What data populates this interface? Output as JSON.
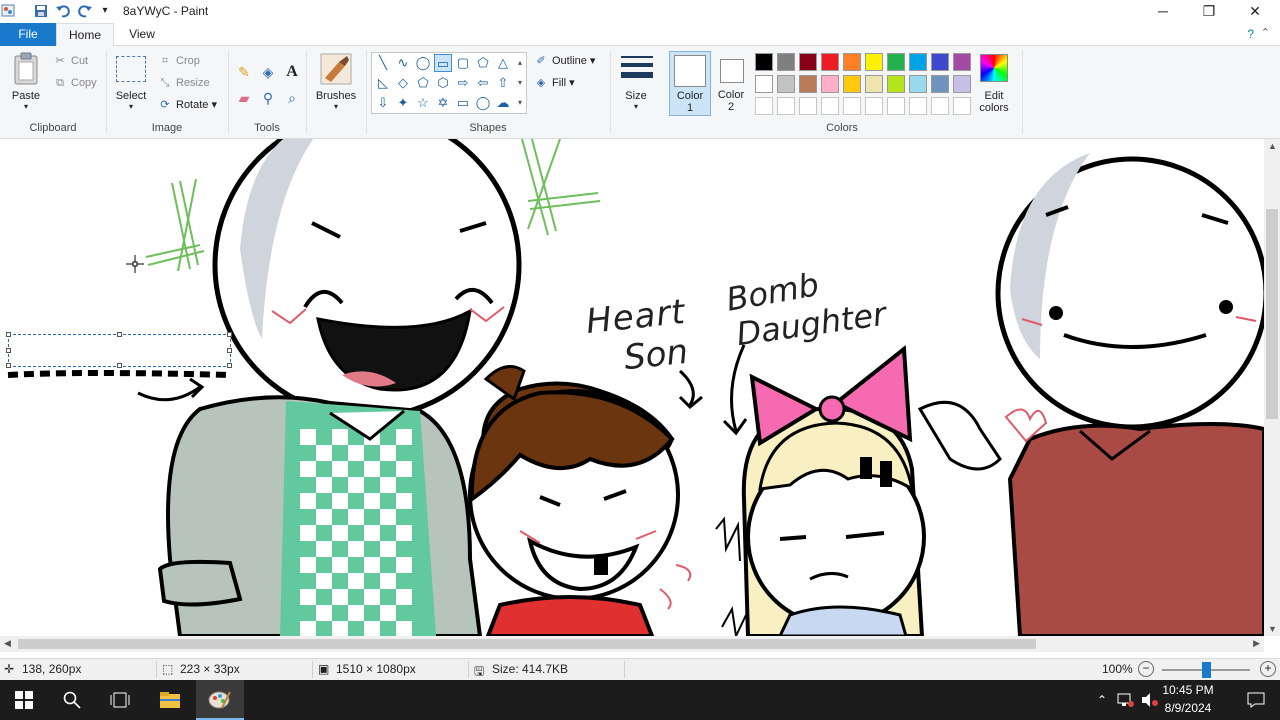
{
  "window": {
    "title": "8aYWyC - Paint",
    "minimize_glyph": "─",
    "maximize_glyph": "❐",
    "close_glyph": "✕"
  },
  "tabs": {
    "file": "File",
    "home": "Home",
    "view": "View"
  },
  "ribbon": {
    "clipboard": {
      "paste": "Paste",
      "cut": "Cut",
      "copy": "Copy",
      "group": "Clipboard"
    },
    "image": {
      "select": "Select",
      "crop": "Crop",
      "resize": "Resize",
      "rotate": "Rotate",
      "group": "Image"
    },
    "tools": {
      "group": "Tools"
    },
    "brushes": {
      "label": "Brushes"
    },
    "shapes": {
      "outline": "Outline",
      "fill": "Fill",
      "group": "Shapes"
    },
    "size": {
      "label": "Size"
    },
    "color1": {
      "line1": "Color",
      "line2": "1"
    },
    "color2": {
      "line1": "Color",
      "line2": "2"
    },
    "colors": {
      "group": "Colors",
      "edit_line1": "Edit",
      "edit_line2": "colors",
      "palette_row1": [
        "#000000",
        "#7f7f7f",
        "#880015",
        "#ed1c24",
        "#ff7f27",
        "#fff200",
        "#22b14c",
        "#00a2e8",
        "#3f48cc",
        "#a349a4"
      ],
      "palette_row2": [
        "#ffffff",
        "#c3c3c3",
        "#b97a57",
        "#ffaec9",
        "#ffc90e",
        "#efe4b0",
        "#b5e61d",
        "#99d9ea",
        "#7092be",
        "#c8bfe7"
      ]
    }
  },
  "canvas": {
    "annotation_heart": "Heart",
    "annotation_son": "Son",
    "annotation_bomb": "Bomb",
    "annotation_daughter": "Daughter"
  },
  "status": {
    "cursor_pos": "138, 260px",
    "selection_size": "223 × 33px",
    "image_size": "1510 × 1080px",
    "file_size": "Size: 414.7KB",
    "zoom": "100%"
  },
  "taskbar": {
    "time": "10:45 PM",
    "date": "8/9/2024"
  }
}
